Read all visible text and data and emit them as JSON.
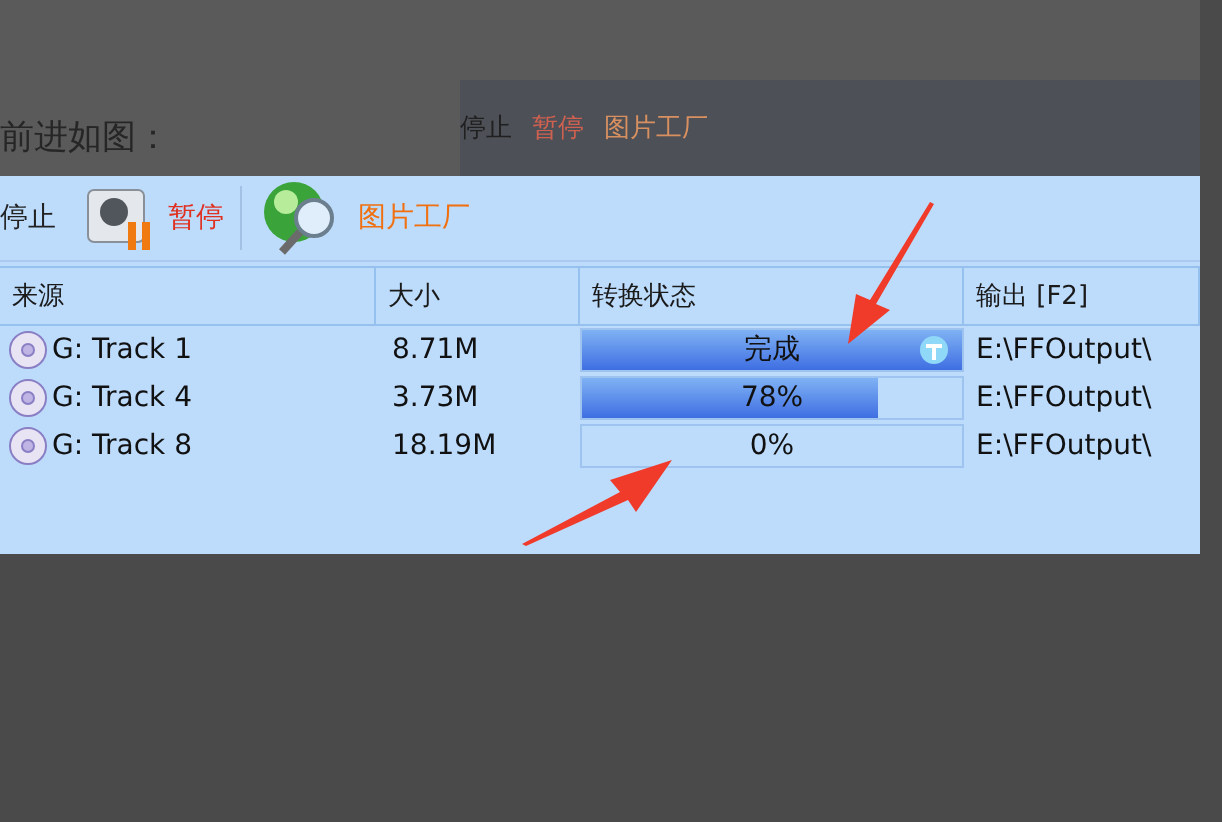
{
  "page_text": "前进如图：",
  "background_toolbar": [
    {
      "label": "停止"
    },
    {
      "label": "暂停"
    },
    {
      "label": "图片工厂"
    }
  ],
  "toolbar": [
    {
      "label": "停止",
      "kind": "stop"
    },
    {
      "label": "暂停",
      "kind": "pause"
    },
    {
      "label": "图片工厂",
      "kind": "picture"
    }
  ],
  "table": {
    "columns": [
      "来源",
      "大小",
      "转换状态",
      "输出 [F2]"
    ],
    "rows": [
      {
        "source": "G: Track 1",
        "size": "8.71M",
        "status": "完成",
        "level": 1,
        "done": true,
        "output": "E:\\FFOutput\\"
      },
      {
        "source": "G: Track 4",
        "size": "3.73M",
        "status": "78%",
        "level": 0.78,
        "done": false,
        "output": "E:\\FFOutput\\"
      },
      {
        "source": "G: Track 8",
        "size": "18.19M",
        "status": "0%",
        "level": 0,
        "done": false,
        "output": "E:\\FFOutput\\"
      }
    ]
  }
}
